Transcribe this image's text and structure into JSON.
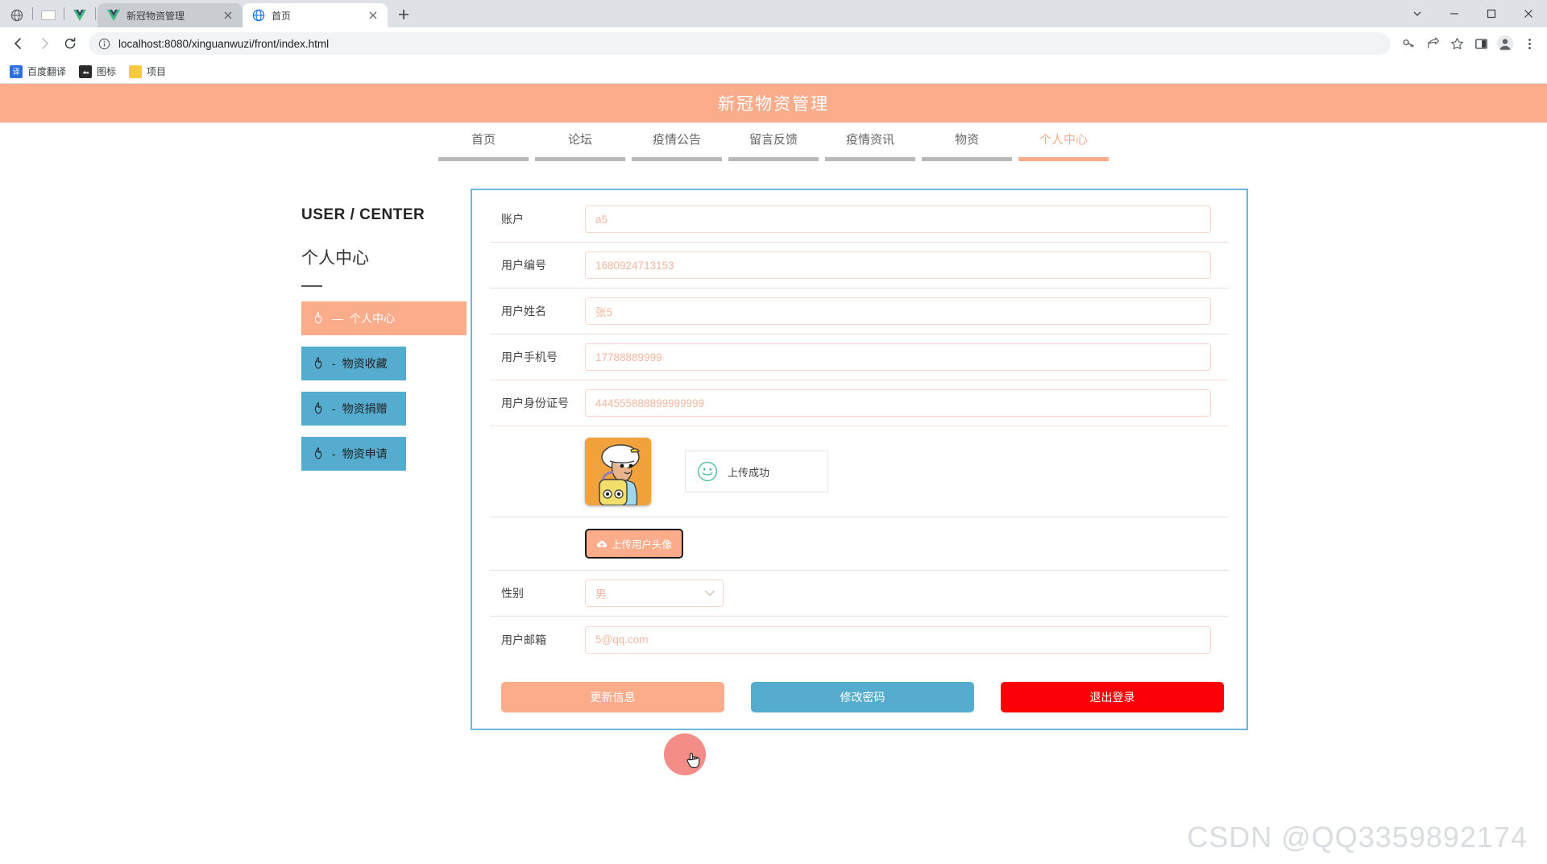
{
  "browser": {
    "tabs": [
      {
        "title": "新冠物资管理",
        "active": false,
        "favicon": "vue-icon"
      },
      {
        "title": "首页",
        "active": true,
        "favicon": "globe-icon"
      }
    ],
    "url": "localhost:8080/xinguanwuzi/front/index.html",
    "bookmarks": [
      {
        "label": "百度翻译",
        "icon": "translate-icon"
      },
      {
        "label": "图标",
        "icon": "image-icon"
      },
      {
        "label": "项目",
        "icon": "folder-icon"
      }
    ],
    "toolbar_icons": [
      "back-icon",
      "forward-icon",
      "reload-icon",
      "info-icon",
      "key-icon",
      "share-icon",
      "star-icon",
      "side-panel-icon",
      "profile-icon",
      "menu-icon"
    ],
    "window_buttons": [
      "minimize-icon",
      "maximize-icon",
      "close-icon"
    ]
  },
  "site": {
    "title": "新冠物资管理",
    "accent": "#FBAC8B",
    "blue": "#55ACCE",
    "red": "#FB0007",
    "nav": [
      {
        "label": "首页",
        "active": false
      },
      {
        "label": "论坛",
        "active": false
      },
      {
        "label": "疫情公告",
        "active": false
      },
      {
        "label": "留言反馈",
        "active": false
      },
      {
        "label": "疫情资讯",
        "active": false
      },
      {
        "label": "物资",
        "active": false
      },
      {
        "label": "个人中心",
        "active": true
      }
    ]
  },
  "sidebar": {
    "en_title": "USER / CENTER",
    "cn_title": "个人中心",
    "items": [
      {
        "label": "个人中心",
        "dash": "—",
        "active": true
      },
      {
        "label": "物资收藏",
        "dash": "-",
        "active": false
      },
      {
        "label": "物资捐赠",
        "dash": "-",
        "active": false
      },
      {
        "label": "物资申请",
        "dash": "-",
        "active": false
      }
    ]
  },
  "form": {
    "fields": [
      {
        "label": "账户",
        "value": "a5"
      },
      {
        "label": "用户编号",
        "value": "1680924713153"
      },
      {
        "label": "用户姓名",
        "value": "张5"
      },
      {
        "label": "用户手机号",
        "value": "17788889999"
      },
      {
        "label": "用户身份证号",
        "value": "444555888899999999"
      }
    ],
    "upload": {
      "status_text": "上传成功",
      "button_label": "上传用户头像"
    },
    "gender": {
      "label": "性别",
      "value": "男"
    },
    "email": {
      "label": "用户邮箱",
      "value": "5@qq.com"
    },
    "buttons": [
      {
        "label": "更新信息",
        "style": "update"
      },
      {
        "label": "修改密码",
        "style": "pwd"
      },
      {
        "label": "退出登录",
        "style": "logout"
      }
    ]
  },
  "watermark": "CSDN @QQ3359892174"
}
